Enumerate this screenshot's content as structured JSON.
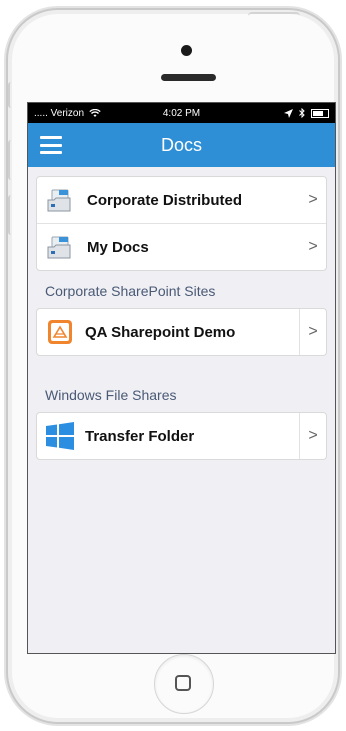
{
  "status_bar": {
    "carrier": "..... Verizon",
    "time": "4:02 PM"
  },
  "nav": {
    "title": "Docs"
  },
  "colors": {
    "accent": "#2f8fd6",
    "background": "#efeff4",
    "section_header": "#4a5a75"
  },
  "groups": [
    {
      "header": "",
      "items": [
        {
          "label": "Corporate Distributed",
          "icon": "folder-doc-icon"
        },
        {
          "label": "My Docs",
          "icon": "folder-doc-icon"
        }
      ]
    },
    {
      "header": "Corporate SharePoint Sites",
      "items": [
        {
          "label": "QA Sharepoint Demo",
          "icon": "sharepoint-icon"
        }
      ]
    },
    {
      "header": "Windows File Shares",
      "items": [
        {
          "label": "Transfer Folder",
          "icon": "windows-icon"
        }
      ]
    }
  ],
  "chevron": ">"
}
